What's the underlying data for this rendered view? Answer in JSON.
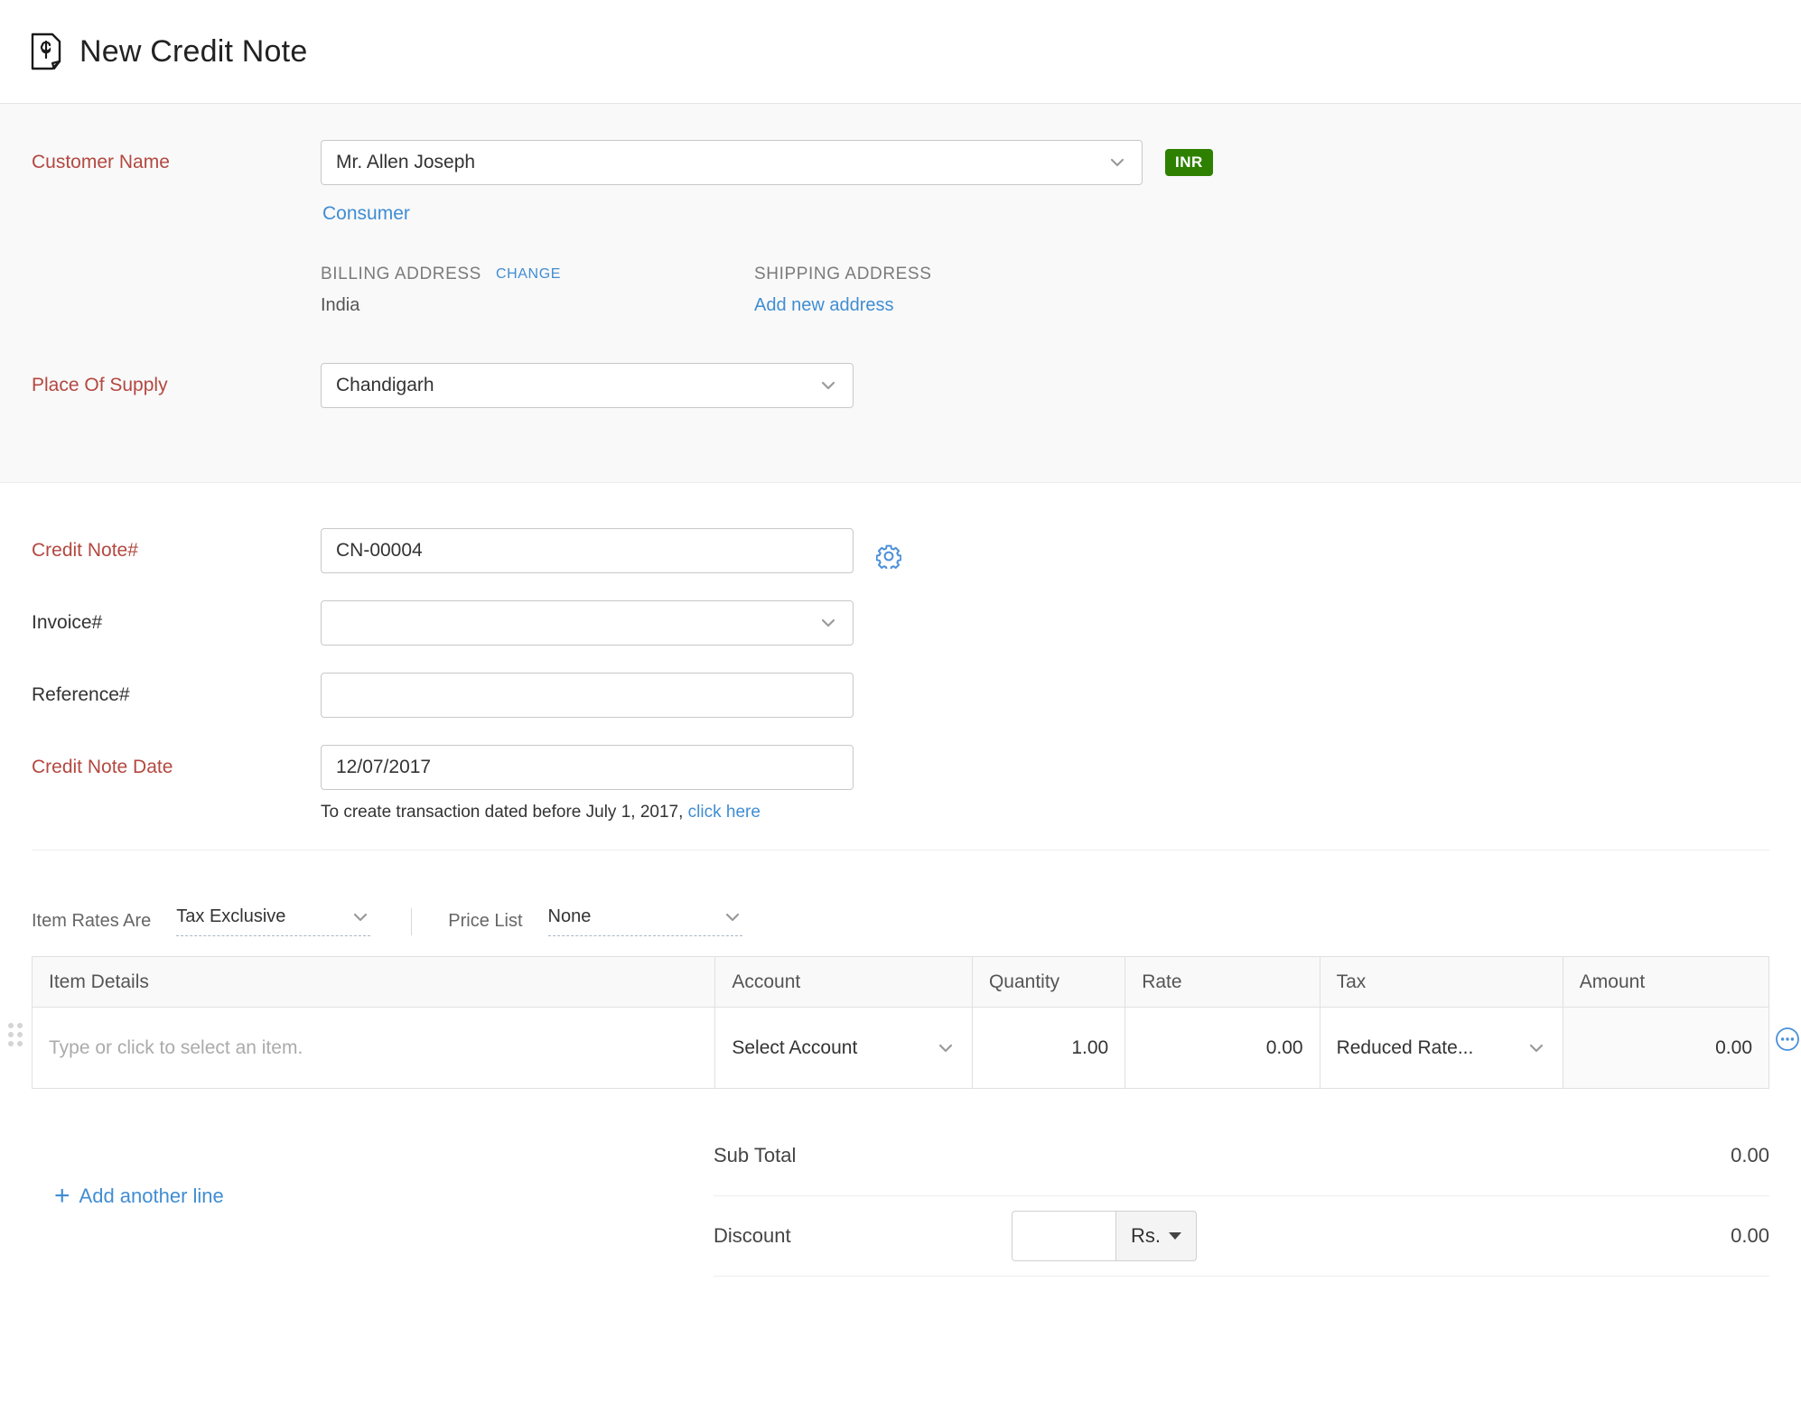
{
  "header": {
    "title": "New Credit Note",
    "icon": "credit-note-document-icon"
  },
  "customer_section": {
    "customer_name_label": "Customer Name",
    "customer_name_value": "Mr. Allen Joseph",
    "currency_badge": "INR",
    "customer_type_link": "Consumer",
    "billing_address_heading": "BILLING ADDRESS",
    "billing_change_link": "CHANGE",
    "billing_address_value": "India",
    "shipping_address_heading": "SHIPPING ADDRESS",
    "shipping_add_link": "Add new address",
    "place_of_supply_label": "Place Of Supply",
    "place_of_supply_value": "Chandigarh"
  },
  "details_section": {
    "credit_note_number_label": "Credit Note#",
    "credit_note_number_value": "CN-00004",
    "settings_icon": "gear-icon",
    "invoice_number_label": "Invoice#",
    "invoice_number_value": "",
    "reference_number_label": "Reference#",
    "reference_number_value": "",
    "credit_note_date_label": "Credit Note Date",
    "credit_note_date_value": "12/07/2017",
    "date_hint_text": "To create transaction dated before July 1, 2017,",
    "date_hint_link": "click here"
  },
  "rates_bar": {
    "item_rates_label": "Item Rates Are",
    "item_rates_value": "Tax Exclusive",
    "price_list_label": "Price List",
    "price_list_value": "None"
  },
  "items_table": {
    "columns": [
      "Item Details",
      "Account",
      "Quantity",
      "Rate",
      "Tax",
      "Amount"
    ],
    "rows": [
      {
        "item_details_placeholder": "Type or click to select an item.",
        "account": "Select Account",
        "quantity": "1.00",
        "rate": "0.00",
        "tax": "Reduced Rate...",
        "amount": "0.00"
      }
    ],
    "add_line_label": "Add another line",
    "add_line_plus": "+",
    "row_more_icon": "ellipsis-circle-icon",
    "row_remove_icon": "remove-circle-icon"
  },
  "totals": {
    "sub_total_label": "Sub Total",
    "sub_total_value": "0.00",
    "discount_label": "Discount",
    "discount_value": "",
    "discount_unit": "Rs."
  },
  "colors": {
    "required_label": "#b34840",
    "link": "#408dd2",
    "currency_badge_bg": "#2e8000",
    "section_bg": "#f9f9f9",
    "remove_icon": "#f09a9a"
  }
}
